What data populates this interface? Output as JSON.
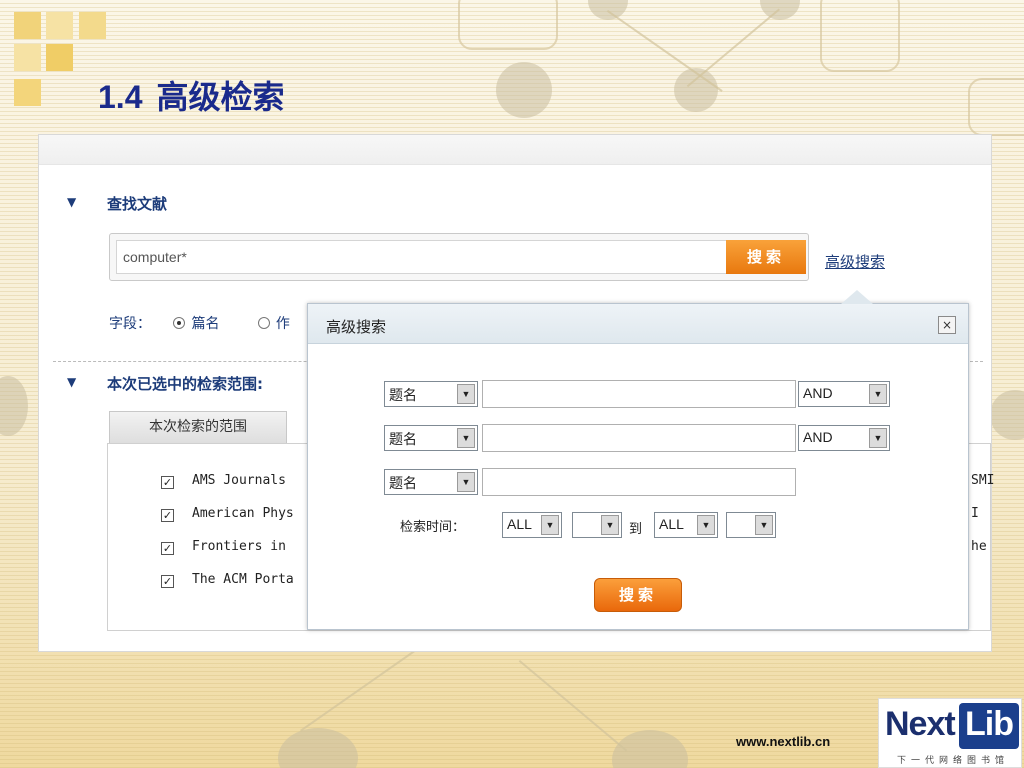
{
  "slide": {
    "title_number": "1.4",
    "title_text": "高级检索",
    "url": "www.nextlib.cn",
    "logo": {
      "word1": "Next",
      "word2": "Lib",
      "subtitle": "下一代网络图书馆"
    }
  },
  "screenshot": {
    "find_section": {
      "title": "查找文献"
    },
    "search": {
      "value": "computer*",
      "button": "搜索"
    },
    "advanced_link": "高级搜索",
    "field_row": {
      "label": "字段：",
      "option1": "篇名",
      "option2": "作"
    },
    "scope_section": {
      "title": "本次已选中的检索范围:"
    },
    "scope_tab": "本次检索的范围",
    "databases": [
      {
        "name": "AMS Journals",
        "checked": true
      },
      {
        "name": "American Phys",
        "checked": true
      },
      {
        "name": "Frontiers in",
        "checked": true
      },
      {
        "name": "The ACM Porta",
        "checked": true
      }
    ],
    "right_fragments": [
      "SMI",
      "I",
      "he"
    ]
  },
  "modal": {
    "title": "高级搜索",
    "close": "×",
    "rows": [
      {
        "field": "题名",
        "op": "AND"
      },
      {
        "field": "题名",
        "op": "AND"
      },
      {
        "field": "题名"
      }
    ],
    "time": {
      "label": "检索时间：",
      "from_year": "ALL",
      "to_label": "到",
      "to_year": "ALL"
    },
    "search_button": "搜索"
  }
}
